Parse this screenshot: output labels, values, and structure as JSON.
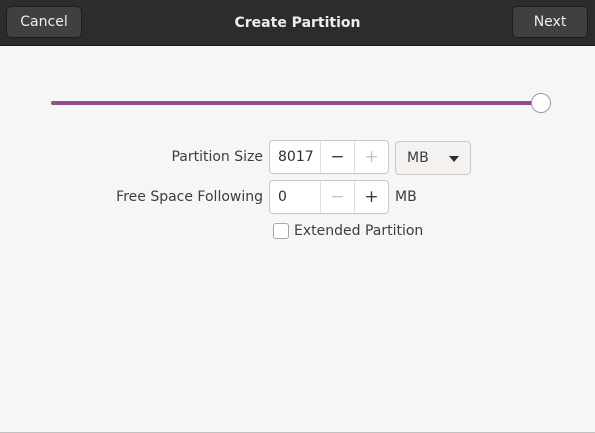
{
  "header": {
    "title": "Create Partition",
    "cancel_label": "Cancel",
    "next_label": "Next"
  },
  "slider": {
    "fraction": 1.0,
    "accent": "#924d8b"
  },
  "partition_size": {
    "label": "Partition Size",
    "value": "8017",
    "minus": "−",
    "plus": "+",
    "unit_selected": "MB"
  },
  "free_space_following": {
    "label": "Free Space Following",
    "value": "0",
    "minus": "−",
    "plus": "+",
    "unit": "MB"
  },
  "extended_partition": {
    "label": "Extended Partition",
    "checked": false
  }
}
